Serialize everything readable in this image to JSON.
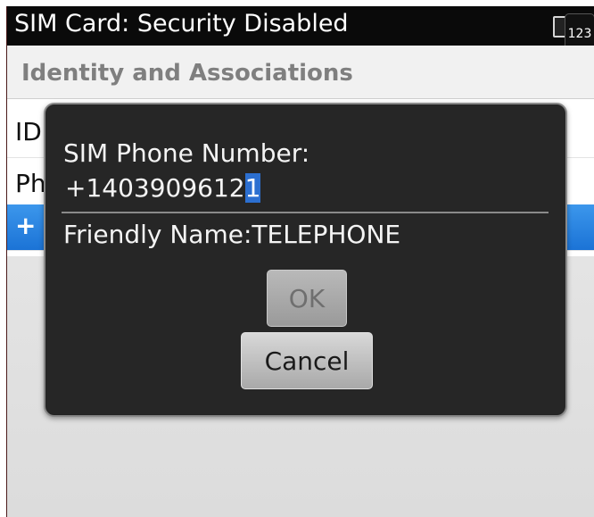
{
  "titlebar": {
    "title": "SIM Card: Security Disabled",
    "icons": [
      "battery-icon"
    ],
    "input_mode": "123"
  },
  "list": {
    "section_header": "Identity and Associations",
    "rows": [
      {
        "label": "ID"
      },
      {
        "label": "Ph"
      },
      {
        "label": "+"
      }
    ]
  },
  "dialog": {
    "phone_label": "SIM Phone Number:",
    "phone_value_main": "+1403909612",
    "phone_value_cursor": "1",
    "friendly_name": "Friendly Name:TELEPHONE",
    "ok_label": "OK",
    "cancel_label": "Cancel"
  },
  "colors": {
    "titlebar_bg": "#0a0a0a",
    "selection_blue": "#1b73d6",
    "dialog_bg": "#262626",
    "cursor_highlight": "#2c6fd0"
  }
}
